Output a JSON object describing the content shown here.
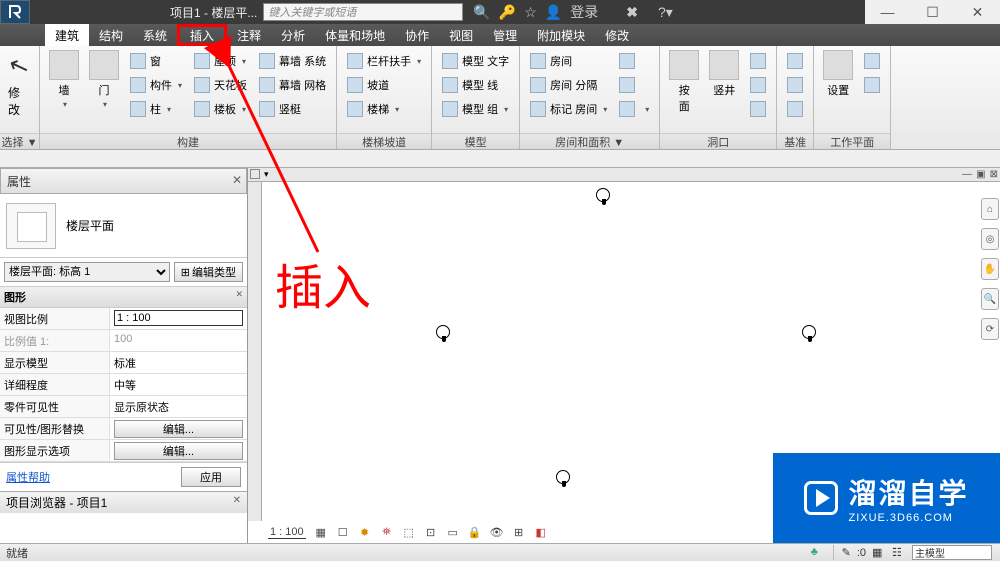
{
  "title": "项目1 - 楼层平...",
  "search_placeholder": "键入关键字或短语",
  "login": "登录",
  "win": {
    "min": "—",
    "max": "☐",
    "close": "✕"
  },
  "tabs": [
    "建筑",
    "结构",
    "系统",
    "插入",
    "注释",
    "分析",
    "体量和场地",
    "协作",
    "视图",
    "管理",
    "附加模块",
    "修改"
  ],
  "active_tab_index": 0,
  "highlight_tab_index": 3,
  "ribbon": {
    "select": {
      "label": "修改",
      "footer": "选择 ▼"
    },
    "build": {
      "footer": "构建",
      "big": [
        {
          "label": "墙"
        },
        {
          "label": "门"
        }
      ],
      "cols": [
        [
          {
            "label": "窗"
          },
          {
            "label": "构件",
            "dd": true
          },
          {
            "label": "柱",
            "dd": true
          }
        ],
        [
          {
            "label": "屋顶",
            "dd": true
          },
          {
            "label": "天花板"
          },
          {
            "label": "楼板",
            "dd": true
          }
        ],
        [
          {
            "label": "幕墙 系统"
          },
          {
            "label": "幕墙 网格"
          },
          {
            "label": "竖梃"
          }
        ]
      ]
    },
    "stair": {
      "footer": "楼梯坡道",
      "items": [
        {
          "label": "栏杆扶手",
          "dd": true
        },
        {
          "label": "坡道"
        },
        {
          "label": "楼梯",
          "dd": true
        }
      ]
    },
    "model": {
      "footer": "模型",
      "items": [
        {
          "label": "模型 文字"
        },
        {
          "label": "模型 线"
        },
        {
          "label": "模型 组",
          "dd": true
        }
      ]
    },
    "room": {
      "footer": "房间和面积 ▼",
      "items": [
        {
          "label": "房间"
        },
        {
          "label": "房间 分隔"
        },
        {
          "label": "标记 房间",
          "dd": true
        }
      ],
      "extra": [
        {
          "label": ""
        },
        {
          "label": ""
        },
        {
          "label": "",
          "dd": true
        }
      ]
    },
    "opening": {
      "footer": "洞口",
      "big": [
        {
          "label": "按\n面"
        },
        {
          "label": "竖井"
        }
      ],
      "icons": 3
    },
    "datum": {
      "footer": "基准",
      "icons": 3
    },
    "work": {
      "footer": "工作平面",
      "big": [
        {
          "label": "设置"
        }
      ],
      "icons": 2
    }
  },
  "properties": {
    "title": "属性",
    "type_name": "楼层平面",
    "selector": "楼层平面: 标高 1",
    "edit_type": "编辑类型",
    "cat": "图形",
    "rows": [
      {
        "k": "视图比例",
        "v": "1 : 100",
        "input": true
      },
      {
        "k": "比例值 1:",
        "v": "100",
        "dim": true
      },
      {
        "k": "显示模型",
        "v": "标准"
      },
      {
        "k": "详细程度",
        "v": "中等"
      },
      {
        "k": "零件可见性",
        "v": "显示原状态"
      },
      {
        "k": "可见性/图形替换",
        "btn": "编辑..."
      },
      {
        "k": "图形显示选项",
        "btn": "编辑..."
      }
    ],
    "help": "属性帮助",
    "apply": "应用"
  },
  "browser_title": "项目浏览器 - 项目1",
  "viewbar": {
    "scale": "1 : 100"
  },
  "status": {
    "ready": "就绪",
    "zero": ":0",
    "model": "主模型"
  },
  "annotation": "插入",
  "watermark": {
    "title": "溜溜自学",
    "url": "ZIXUE.3D66.COM"
  }
}
